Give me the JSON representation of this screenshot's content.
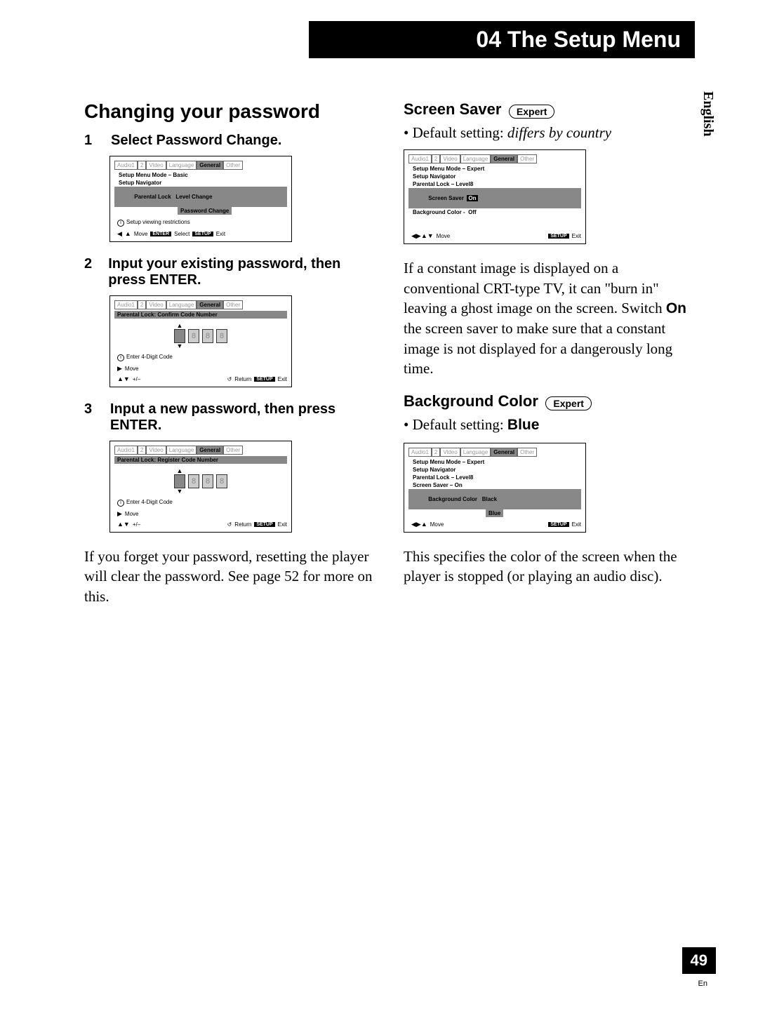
{
  "chapter": {
    "number": "04",
    "title": "The Setup Menu"
  },
  "language_tab": "English",
  "page_number": "49",
  "page_lang_code": "En",
  "left": {
    "heading": "Changing your password",
    "steps": [
      {
        "num": "1",
        "title": "Select Password Change."
      },
      {
        "num": "2",
        "title": "Input your existing password, then press ENTER."
      },
      {
        "num": "3",
        "title": "Input a new password, then press ENTER."
      }
    ],
    "note": "If you forget your password, resetting the player will clear the password. See page 52 for more on this.",
    "shot1": {
      "tabs": [
        "Audio1",
        "2",
        "Video",
        "Language",
        "General",
        "Other"
      ],
      "lines": {
        "mode": "Setup Menu Mode – Basic",
        "nav": "Setup Navigator",
        "parental": "Parental Lock",
        "level": "Level Change",
        "pwd": "Password Change"
      },
      "hint": "Setup viewing restrictions",
      "footer": {
        "move": "Move",
        "enter": "ENTER",
        "select": "Select",
        "setup": "SETUP",
        "exit": "Exit"
      }
    },
    "shot2": {
      "tabs": [
        "Audio1",
        "2",
        "Video",
        "Language",
        "General",
        "Other"
      ],
      "title": "Parental Lock: Confirm Code Number",
      "digits": [
        "8",
        "8",
        "8",
        "8"
      ],
      "hint": "Enter 4-Digit Code",
      "footer": {
        "move": "Move",
        "plusminus": "+/–",
        "return": "Return",
        "setup": "SETUP",
        "exit": "Exit"
      }
    },
    "shot3": {
      "tabs": [
        "Audio1",
        "2",
        "Video",
        "Language",
        "General",
        "Other"
      ],
      "title": "Parental Lock: Register Code Number",
      "digits": [
        "8",
        "8",
        "8",
        "8"
      ],
      "hint": "Enter 4-Digit Code",
      "footer": {
        "move": "Move",
        "plusminus": "+/–",
        "return": "Return",
        "setup": "SETUP",
        "exit": "Exit"
      }
    }
  },
  "right": {
    "screenSaver": {
      "heading": "Screen Saver",
      "badge": "Expert",
      "default_prefix": "Default setting: ",
      "default_value": "differs by country",
      "body_pre": "If a constant image is displayed on a conventional CRT-type TV, it can \"burn in\" leaving a ghost image on the screen. Switch ",
      "body_bold": "On",
      "body_post": " the screen saver to make sure that a constant image is not displayed for a dangerously long time.",
      "shot": {
        "tabs": [
          "Audio1",
          "2",
          "Video",
          "Language",
          "General",
          "Other"
        ],
        "lines": {
          "mode": "Setup Menu Mode – Expert",
          "nav": "Setup Navigator",
          "parental": "Parental Lock – Level8",
          "saver": "Screen Saver",
          "on": "On",
          "bg": "Background Color -  Off"
        },
        "footer": {
          "move": "Move",
          "setup": "SETUP",
          "exit": "Exit"
        }
      }
    },
    "backgroundColor": {
      "heading": "Background Color",
      "badge": "Expert",
      "default_prefix": "Default setting: ",
      "default_value": "Blue",
      "body": "This specifies the color of the screen when the player is stopped (or playing an audio disc).",
      "shot": {
        "tabs": [
          "Audio1",
          "2",
          "Video",
          "Language",
          "General",
          "Other"
        ],
        "lines": {
          "mode": "Setup Menu Mode – Expert",
          "nav": "Setup Navigator",
          "parental": "Parental Lock – Level8",
          "saver": "Screen Saver – On",
          "bg": "Background Color",
          "black": "Black",
          "blue": "Blue"
        },
        "footer": {
          "move": "Move",
          "setup": "SETUP",
          "exit": "Exit"
        }
      }
    }
  }
}
